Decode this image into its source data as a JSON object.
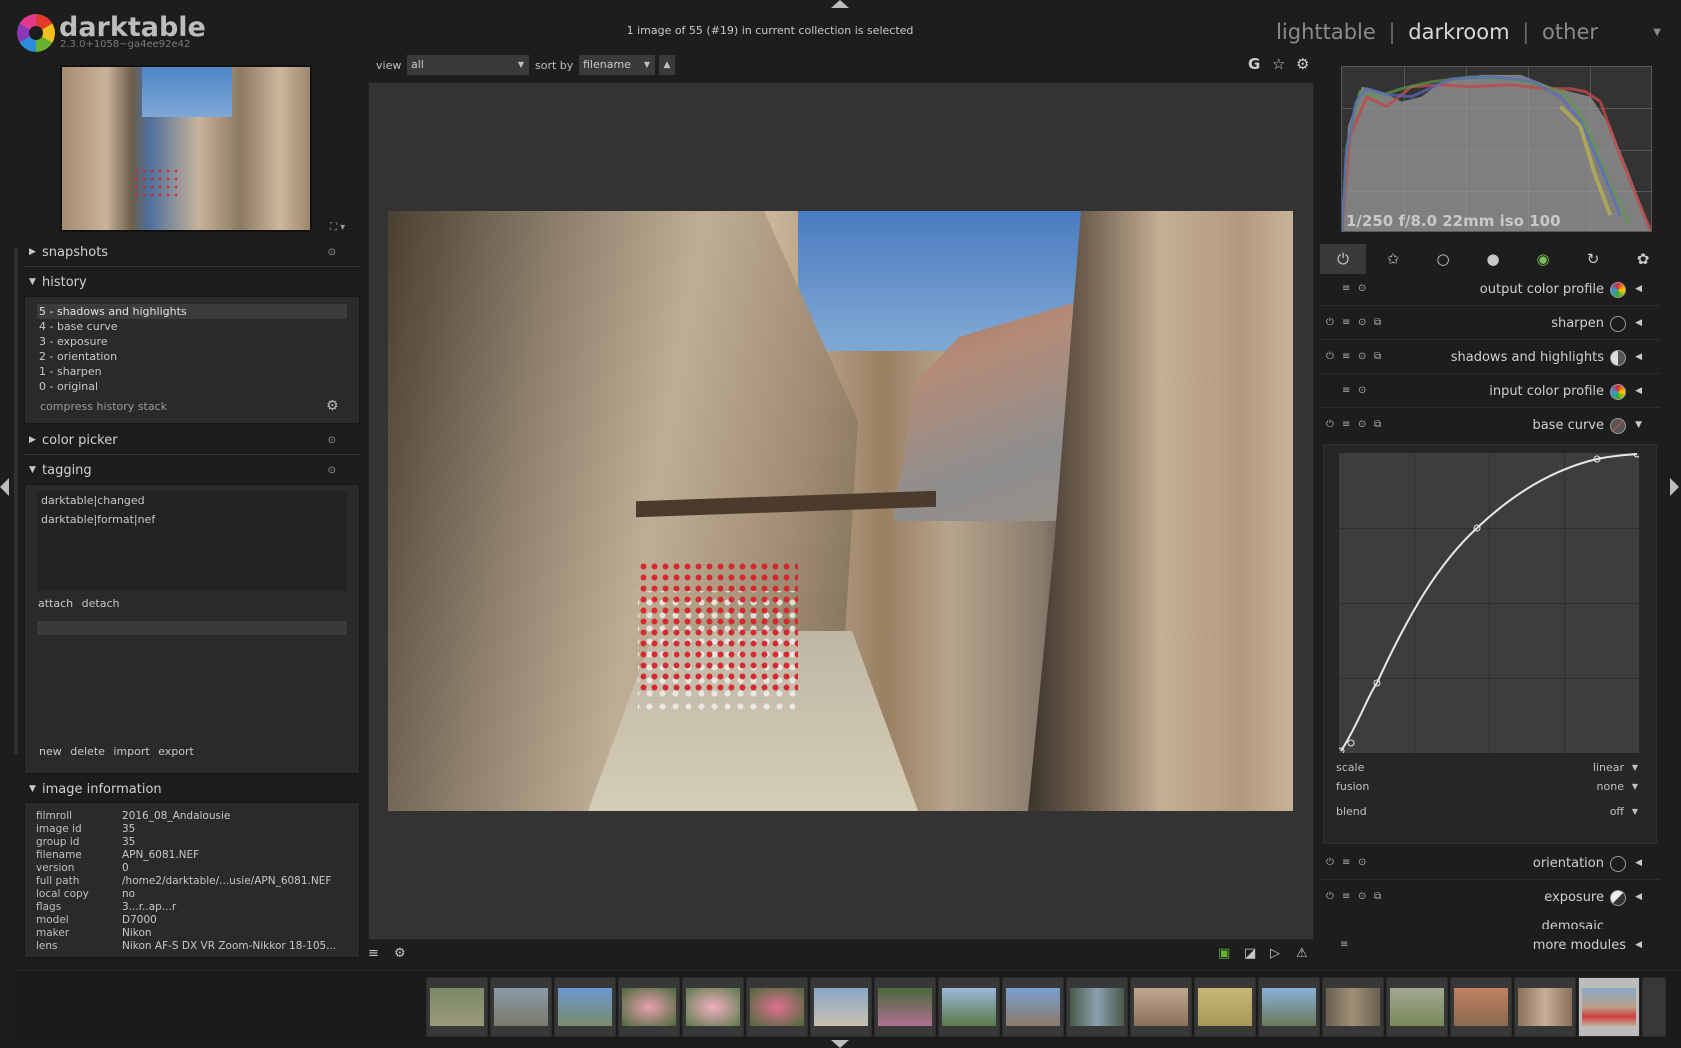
{
  "app": {
    "name": "darktable",
    "version": "2.3.0+1058~ga4ee92e42",
    "selection_status": "1 image of 55 (#19) in current collection is selected"
  },
  "views": {
    "lighttable": "lighttable",
    "separator": "|",
    "darkroom": "darkroom",
    "other": "other"
  },
  "left_panel": {
    "snapshots": {
      "title": "snapshots"
    },
    "history": {
      "title": "history",
      "items": [
        "5 - shadows and highlights",
        "4 - base curve",
        "3 - exposure",
        "2 - orientation",
        "1 - sharpen",
        "0 - original"
      ],
      "compress_label": "compress history stack"
    },
    "color_picker": {
      "title": "color picker"
    },
    "tagging": {
      "title": "tagging",
      "attached_tags": [
        "darktable|changed",
        "darktable|format|nef"
      ],
      "attach_label": "attach",
      "detach_label": "detach",
      "new_label": "new",
      "delete_label": "delete",
      "import_label": "import",
      "export_label": "export"
    },
    "image_information": {
      "title": "image information",
      "rows": [
        {
          "k": "filmroll",
          "v": "2016_08_Andalousie"
        },
        {
          "k": "image id",
          "v": "35"
        },
        {
          "k": "group id",
          "v": "35"
        },
        {
          "k": "filename",
          "v": "APN_6081.NEF"
        },
        {
          "k": "version",
          "v": "0"
        },
        {
          "k": "full path",
          "v": "/home2/darktable/...usie/APN_6081.NEF"
        },
        {
          "k": "local copy",
          "v": "no"
        },
        {
          "k": "flags",
          "v": "3...r..ap...r"
        },
        {
          "k": "model",
          "v": "D7000"
        },
        {
          "k": "maker",
          "v": "Nikon"
        },
        {
          "k": "lens",
          "v": "Nikon AF-S DX VR Zoom-Nikkor 18-105..."
        }
      ]
    }
  },
  "center_toolbar": {
    "view_label": "view",
    "view_value": "all",
    "sort_label": "sort by",
    "sort_value": "filename",
    "sort_direction": "▲",
    "grouping_icon_glyph": "G",
    "star_icon_glyph": "☆",
    "gear_icon_glyph": "⚙"
  },
  "histogram": {
    "exif": "1/250 f/8.0 22mm iso 100"
  },
  "modules": [
    {
      "name": "output color profile",
      "expanded": false
    },
    {
      "name": "sharpen",
      "expanded": false
    },
    {
      "name": "shadows and highlights",
      "expanded": false
    },
    {
      "name": "input color profile",
      "expanded": false
    },
    {
      "name": "base curve",
      "expanded": true
    },
    {
      "name": "orientation",
      "expanded": false
    },
    {
      "name": "exposure",
      "expanded": false
    },
    {
      "name": "demosaic",
      "expanded": false
    }
  ],
  "base_curve": {
    "scale_label": "scale",
    "scale_value": "linear",
    "fusion_label": "fusion",
    "fusion_value": "none",
    "blend_label": "blend",
    "blend_value": "off"
  },
  "more_modules_label": "more modules",
  "colors": {
    "background": "#1d1d1d",
    "panel": "#2a2a2a",
    "center_bg": "#333333",
    "text": "#c8c8c8"
  }
}
